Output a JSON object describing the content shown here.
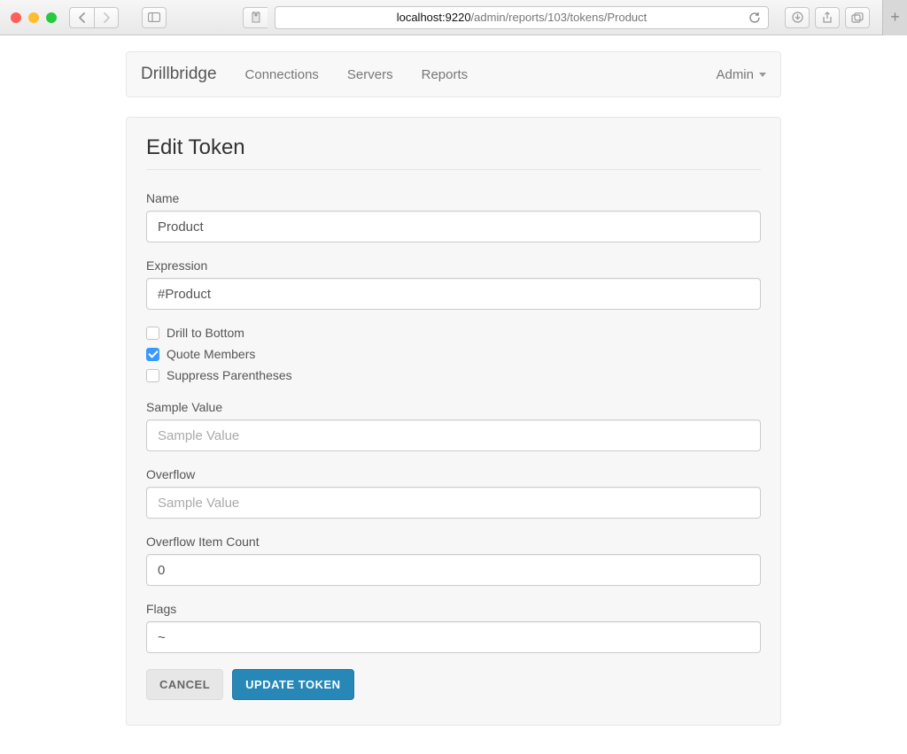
{
  "browser": {
    "url_host": "localhost:9220",
    "url_path": "/admin/reports/103/tokens/Product"
  },
  "navbar": {
    "brand": "Drillbridge",
    "links": [
      "Connections",
      "Servers",
      "Reports"
    ],
    "admin_label": "Admin"
  },
  "panel": {
    "title": "Edit Token"
  },
  "form": {
    "name": {
      "label": "Name",
      "value": "Product"
    },
    "expression": {
      "label": "Expression",
      "value": "#Product"
    },
    "checkboxes": {
      "drill_to_bottom": {
        "label": "Drill to Bottom",
        "checked": false
      },
      "quote_members": {
        "label": "Quote Members",
        "checked": true
      },
      "suppress_parentheses": {
        "label": "Suppress Parentheses",
        "checked": false
      }
    },
    "sample_value": {
      "label": "Sample Value",
      "placeholder": "Sample Value",
      "value": ""
    },
    "overflow": {
      "label": "Overflow",
      "placeholder": "Sample Value",
      "value": ""
    },
    "overflow_item_count": {
      "label": "Overflow Item Count",
      "value": "0"
    },
    "flags": {
      "label": "Flags",
      "value": "~"
    },
    "cancel_label": "CANCEL",
    "submit_label": "UPDATE TOKEN"
  }
}
